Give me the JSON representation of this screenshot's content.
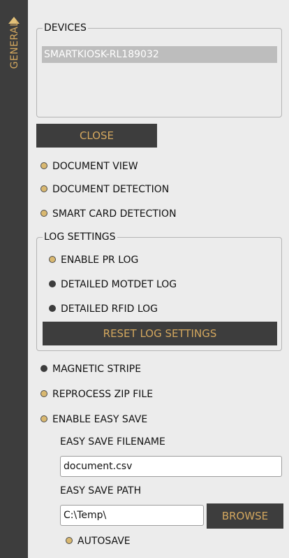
{
  "sidebar": {
    "tab_label": "GENERAL"
  },
  "devices": {
    "legend": "DEVICES",
    "items": [
      "SMARTKIOSK-RL189032"
    ]
  },
  "buttons": {
    "close": "CLOSE",
    "reset_log": "RESET LOG SETTINGS",
    "browse": "BROWSE"
  },
  "options": [
    {
      "label": "DOCUMENT VIEW",
      "enabled": true
    },
    {
      "label": "DOCUMENT DETECTION",
      "enabled": true
    },
    {
      "label": "SMART CARD DETECTION",
      "enabled": true
    }
  ],
  "log_settings": {
    "legend": "LOG SETTINGS",
    "items": [
      {
        "label": "ENABLE PR LOG",
        "enabled": true
      },
      {
        "label": "DETAILED MOTDET LOG",
        "enabled": false
      },
      {
        "label": "DETAILED RFID LOG",
        "enabled": false
      }
    ]
  },
  "more_options": [
    {
      "label": "MAGNETIC STRIPE",
      "enabled": false
    },
    {
      "label": "REPROCESS ZIP FILE",
      "enabled": true
    },
    {
      "label": "ENABLE EASY SAVE",
      "enabled": true
    }
  ],
  "easy_save": {
    "filename_label": "EASY SAVE FILENAME",
    "filename_value": "document.csv",
    "path_label": "EASY SAVE PATH",
    "path_value": "C:\\Temp\\",
    "autosave": {
      "label": "AUTOSAVE",
      "enabled": true
    }
  },
  "colors": {
    "panel": "#3d3d3d",
    "accent": "#d3a75e",
    "dot_on": "#d9b870",
    "dot_off": "#3d3d3d",
    "background": "#ececec"
  }
}
